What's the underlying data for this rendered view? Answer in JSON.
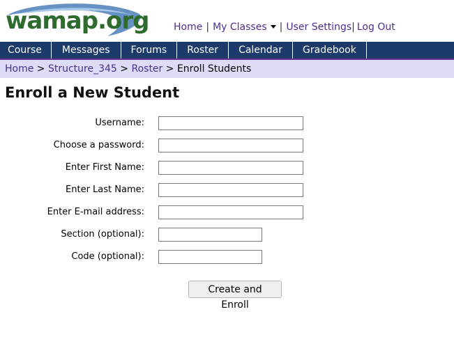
{
  "logo": {
    "text": "wamap.org"
  },
  "top_links": {
    "home": "Home",
    "my_classes": "My Classes",
    "user_settings": "User Settings",
    "log_out": "Log Out"
  },
  "nav": {
    "items": [
      "Course",
      "Messages",
      "Forums",
      "Roster",
      "Calendar",
      "Gradebook"
    ]
  },
  "breadcrumb": {
    "home": "Home",
    "course": "Structure_345",
    "roster": "Roster",
    "current": "Enroll Students"
  },
  "page": {
    "title": "Enroll a New Student"
  },
  "form": {
    "username_label": "Username:",
    "password_label": "Choose a password:",
    "first_name_label": "Enter First Name:",
    "last_name_label": "Enter Last Name:",
    "email_label": "Enter E-mail address:",
    "section_label": "Section (optional):",
    "code_label": "Code (optional):",
    "username_value": "",
    "password_value": "",
    "first_name_value": "",
    "last_name_value": "",
    "email_value": "",
    "section_value": "",
    "code_value": "",
    "submit_label": "Create and Enroll"
  },
  "colors": {
    "nav_bg": "#1c3b6b",
    "breadcrumb_bg": "#dcdcf6",
    "link": "#4b2e91",
    "logo_green": "#2e6b2e",
    "logo_swoosh": "#4a7fb8"
  }
}
